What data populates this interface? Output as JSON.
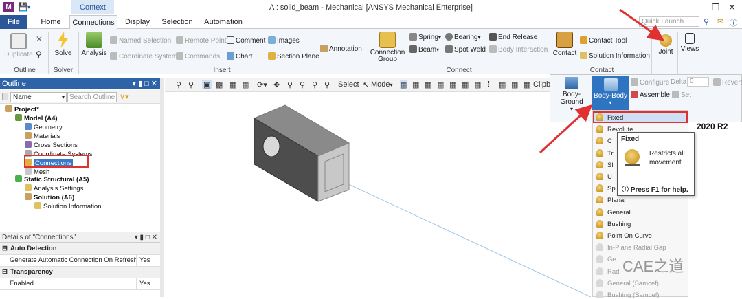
{
  "window": {
    "title": "A : solid_beam - Mechanical [ANSYS Mechanical Enterprise]",
    "context_label": "Context"
  },
  "tabs": [
    "File",
    "Home",
    "Connections",
    "Display",
    "Selection",
    "Automation"
  ],
  "quick_launch_placeholder": "Quick Launch",
  "ribbon": {
    "outline_group": {
      "duplicate": "Duplicate",
      "label": "Outline"
    },
    "solver_group": {
      "solve": "Solve",
      "label": "Solver"
    },
    "insert_group": {
      "analysis": "Analysis",
      "named_selection": "Named Selection",
      "remote_point": "Remote Point",
      "comment": "Comment",
      "images": "Images",
      "coordinate_system": "Coordinate System",
      "commands": "Commands",
      "chart": "Chart",
      "section_plane": "Section Plane",
      "annotation": "Annotation",
      "label": "Insert"
    },
    "connect_group": {
      "connection_group": "Connection Group",
      "spring": "Spring",
      "beam": "Beam",
      "bearing": "Bearing",
      "spot_weld": "Spot Weld",
      "end_release": "End Release",
      "body_interaction": "Body Interaction",
      "label": "Connect"
    },
    "contact_group": {
      "contact": "Contact",
      "contact_tool": "Contact Tool",
      "solution_information": "Solution Information",
      "label": "Contact"
    },
    "joint": "Joint",
    "views": "Views"
  },
  "joint_panel": {
    "body_ground": "Body-Ground",
    "body_body": "Body-Body",
    "configure": "Configure",
    "delta": "Delta",
    "delta_value": "0",
    "revert": "Revert",
    "assemble": "Assemble",
    "set": "Set"
  },
  "joint_types": [
    {
      "label": "Fixed",
      "enabled": true
    },
    {
      "label": "Revolute",
      "enabled": true
    },
    {
      "label": "C",
      "enabled": true
    },
    {
      "label": "Tr",
      "enabled": true
    },
    {
      "label": "Sl",
      "enabled": true
    },
    {
      "label": "U",
      "enabled": true
    },
    {
      "label": "Sp",
      "enabled": true
    },
    {
      "label": "Planar",
      "enabled": true
    },
    {
      "label": "General",
      "enabled": true
    },
    {
      "label": "Bushing",
      "enabled": true
    },
    {
      "label": "Point On Curve",
      "enabled": true
    },
    {
      "label": "In-Plane Radial Gap",
      "enabled": false
    },
    {
      "label": "Ge",
      "enabled": false
    },
    {
      "label": "Radi",
      "enabled": false
    },
    {
      "label": "General (Samcef)",
      "enabled": false
    },
    {
      "label": "Bushing (Samcef)",
      "enabled": false
    }
  ],
  "tooltip": {
    "title": "Fixed",
    "body": "Restricts all movement.",
    "help": "Press F1 for help."
  },
  "version": "2020 R2",
  "outline": {
    "title": "Outline",
    "name_dropdown": "Name",
    "search_placeholder": "Search Outline",
    "tree": [
      {
        "label": "Project*",
        "depth": 0,
        "bold": true
      },
      {
        "label": "Model (A4)",
        "depth": 1,
        "bold": true
      },
      {
        "label": "Geometry",
        "depth": 2,
        "bold": false
      },
      {
        "label": "Materials",
        "depth": 2,
        "bold": false
      },
      {
        "label": "Cross Sections",
        "depth": 2,
        "bold": false
      },
      {
        "label": "Coordinate Systems",
        "depth": 2,
        "bold": false
      },
      {
        "label": "Connections",
        "depth": 2,
        "bold": false
      },
      {
        "label": "Mesh",
        "depth": 2,
        "bold": false
      },
      {
        "label": "Static Structural (A5)",
        "depth": 1,
        "bold": true
      },
      {
        "label": "Analysis Settings",
        "depth": 2,
        "bold": false
      },
      {
        "label": "Solution (A6)",
        "depth": 2,
        "bold": true
      },
      {
        "label": "Solution Information",
        "depth": 3,
        "bold": false
      }
    ]
  },
  "details": {
    "title": "Details of \"Connections\"",
    "sections": [
      {
        "header": "Auto Detection",
        "rows": [
          {
            "name": "Generate Automatic Connection On Refresh",
            "value": "Yes"
          }
        ]
      },
      {
        "header": "Transparency",
        "rows": [
          {
            "name": "Enabled",
            "value": "Yes"
          }
        ]
      }
    ]
  },
  "viewport_toolbar": {
    "select": "Select",
    "mode": "Mode",
    "clipboard": "Clipb"
  },
  "watermark": "CAE之道",
  "colors": {
    "accent": "#2b579a",
    "highlight": "#e03030",
    "selected_tab": "#2f74c0"
  }
}
